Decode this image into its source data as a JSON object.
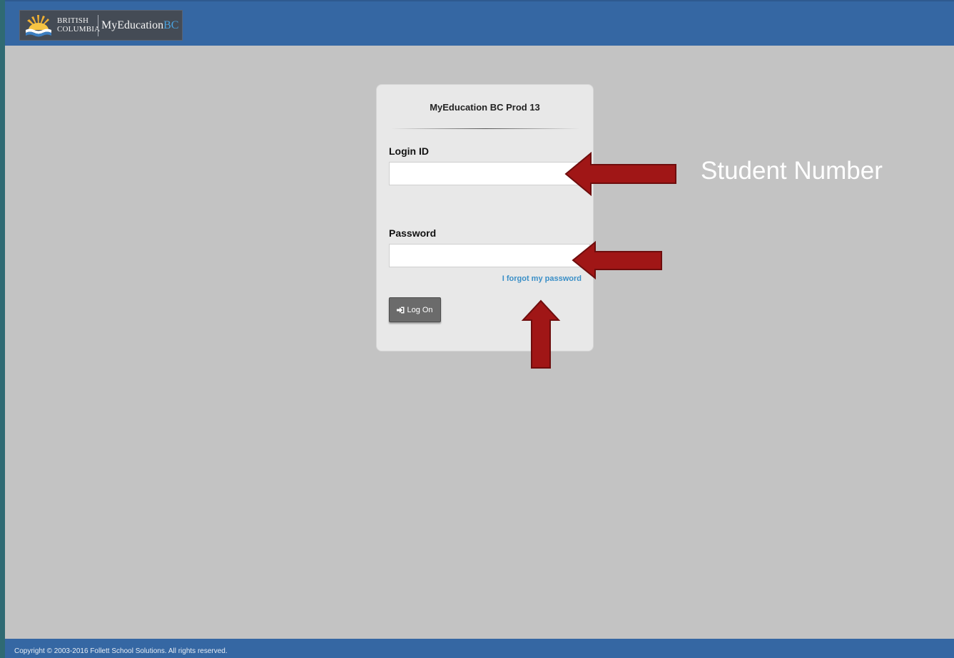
{
  "header": {
    "logo_line1": "BRITISH",
    "logo_line2": "COLUMBIA",
    "brand_main": "MyEducation",
    "brand_suffix": "BC"
  },
  "login_card": {
    "title": "MyEducation BC Prod 13",
    "login_id_label": "Login ID",
    "login_id_value": "",
    "password_label": "Password",
    "password_value": "",
    "forgot_link": "I forgot my password",
    "logon_button": "Log On"
  },
  "annotations": {
    "login_id_note": "Student Number"
  },
  "footer": {
    "copyright": "Copyright © 2003-2016 Follett School Solutions. All rights reserved."
  },
  "colors": {
    "header_bg": "#3567a3",
    "page_bg": "#c3c3c3",
    "arrow_fill": "#a01616",
    "link": "#3a8fc7"
  },
  "icons": {
    "logo": "bc-sunset-logo-icon",
    "logon": "sign-in-icon"
  }
}
